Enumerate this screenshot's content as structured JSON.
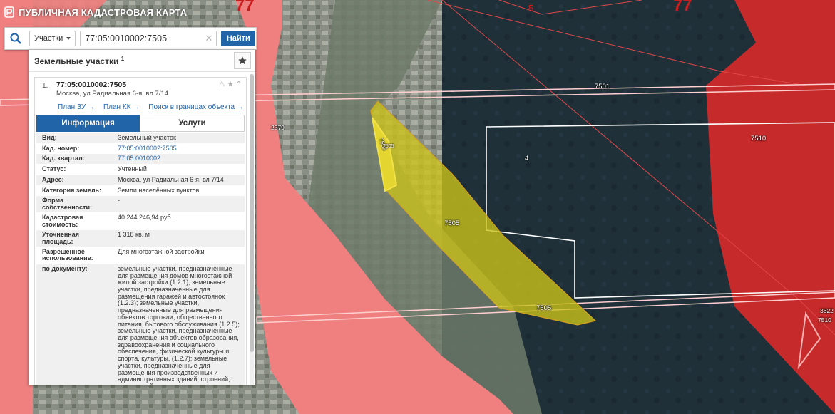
{
  "app": {
    "title": "ПУБЛИЧНАЯ КАДАСТРОВАЯ КАРТА"
  },
  "search": {
    "type_label": "Участки",
    "query": "77:05:0010002:7505",
    "find_label": "Найти"
  },
  "panel": {
    "header": "Земельные участки",
    "count": "1",
    "item": {
      "index": "1.",
      "cad_number": "77:05:0010002:7505",
      "address": "Москва, ул Радиальная 6-я, вл 7/14",
      "links": [
        "План ЗУ →",
        "План КК →",
        "Поиск в границах объекта →"
      ],
      "tabs": [
        "Информация",
        "Услуги"
      ],
      "properties": [
        {
          "k": "Вид:",
          "v": "Земельный участок"
        },
        {
          "k": "Кад. номер:",
          "v": "77:05:0010002:7505"
        },
        {
          "k": "Кад. квартал:",
          "v": "77:05:0010002"
        },
        {
          "k": "Статус:",
          "v": "Учтенный"
        },
        {
          "k": "Адрес:",
          "v": "Москва, ул Радиальная 6-я, вл 7/14"
        },
        {
          "k": "Категория земель:",
          "v": "Земли населённых пунктов"
        },
        {
          "k": "Форма собственности:",
          "v": "-"
        },
        {
          "k": "Кадастровая стоимость:",
          "v": "40 244 246,94 руб."
        },
        {
          "k": "Уточненная площадь:",
          "v": "1 318 кв. м"
        },
        {
          "k": "Разрешенное использование:",
          "v": "Для многоэтажной застройки"
        },
        {
          "k": "по документу:",
          "v": "земельные участки, предназначенные для размещения домов многоэтажной жилой застройки (1.2.1); земельные участки, предназначенные для размещения гаражей и автостоянок (1.2.3); земельные участки, предназначенные для размещения объектов торговли, общественного питания, бытового обслуживания (1.2.5); земельные участки, предназначенные для размещения объектов образования, здравоохранения и социального обеспечения, физической культуры и спорта, культуры, (1.2.7); земельные участки, предназначенные для размещения производственных и административных зданий, строений, сооружений промышленности, материально-технического, продовольственного снабжения, сбыта и заготовок (1.2.9); земельные участки, занятые городскими лесами, скверами"
        }
      ]
    }
  },
  "map": {
    "labels": [
      "77",
      "5",
      "77",
      "7501",
      "7510",
      "2379",
      "4",
      "7505",
      "7505",
      "7505",
      "7505",
      "3622",
      "7510"
    ],
    "colors": {
      "zone_red": "#f07b7b",
      "zone_dark_red": "#c62a2a",
      "parcel_yellow": "#c9c21a",
      "outline": "#e04848"
    }
  }
}
